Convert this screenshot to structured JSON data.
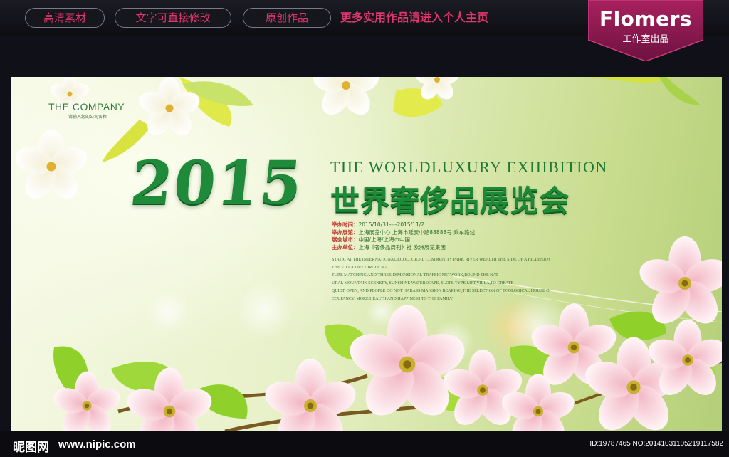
{
  "topbar": {
    "pills": [
      "高清素材",
      "文字可直接修改",
      "原创作品"
    ],
    "more_link": "更多实用作品请进入个人主页",
    "brand_name": "Flomers",
    "brand_sub": "工作室出品"
  },
  "poster": {
    "company": "THE COMPANY",
    "company_sub": "请输入您的公司名称",
    "year": "2015",
    "en_title": "THE WORLDLUXURY EXHIBITION",
    "cn_title": "世界奢侈品展览会",
    "info": [
      {
        "k": "举办时间：",
        "v": "2015/10/31----2015/11/2"
      },
      {
        "k": "举办展馆：",
        "v": "上海展览中心 上海市延安中路88888号 乘车路线"
      },
      {
        "k": "展会城市：",
        "v": "中国/上海/上海市中国"
      },
      {
        "k": "主办单位：",
        "v": "上海《奢侈品周刊》社 欧洲展览集团"
      }
    ],
    "desc": [
      "STATIC AT THE INTERNATIONAL ECOLOGICAL COMMUNITY PARK RIVER WEALTH THE SIDE OF A HILLENJOY",
      "THE VILLA LIFE CIRCLE MA",
      "TURE MATCHING AND THREE-DIMENSIONAL TRAFFIC NETWORK,ROUND THE NAT",
      "URAL MOUNTAIN SCENERY, SUNSHINE WATERSCAPE, SLOPE TYPE LIFT VILLA,TO CREATE",
      "QUIET, OPEN, AND PEOPLE DO NOT HARASS MANSION BEARING,THE SELECTION OF ECOLOGICAL HOUSE O",
      "CCUPANCY, MORE HEALTH AND HAPPINESS TO THE FAMILY."
    ]
  },
  "footer": {
    "site_cn": "昵图网",
    "site_url": "www.nipic.com",
    "id_line": "ID:19787465 NO:20141031105219117582"
  },
  "colors": {
    "accent_pink": "#e0366e",
    "title_green": "#1c8a36",
    "brand_magenta": "#8e1a4e"
  }
}
